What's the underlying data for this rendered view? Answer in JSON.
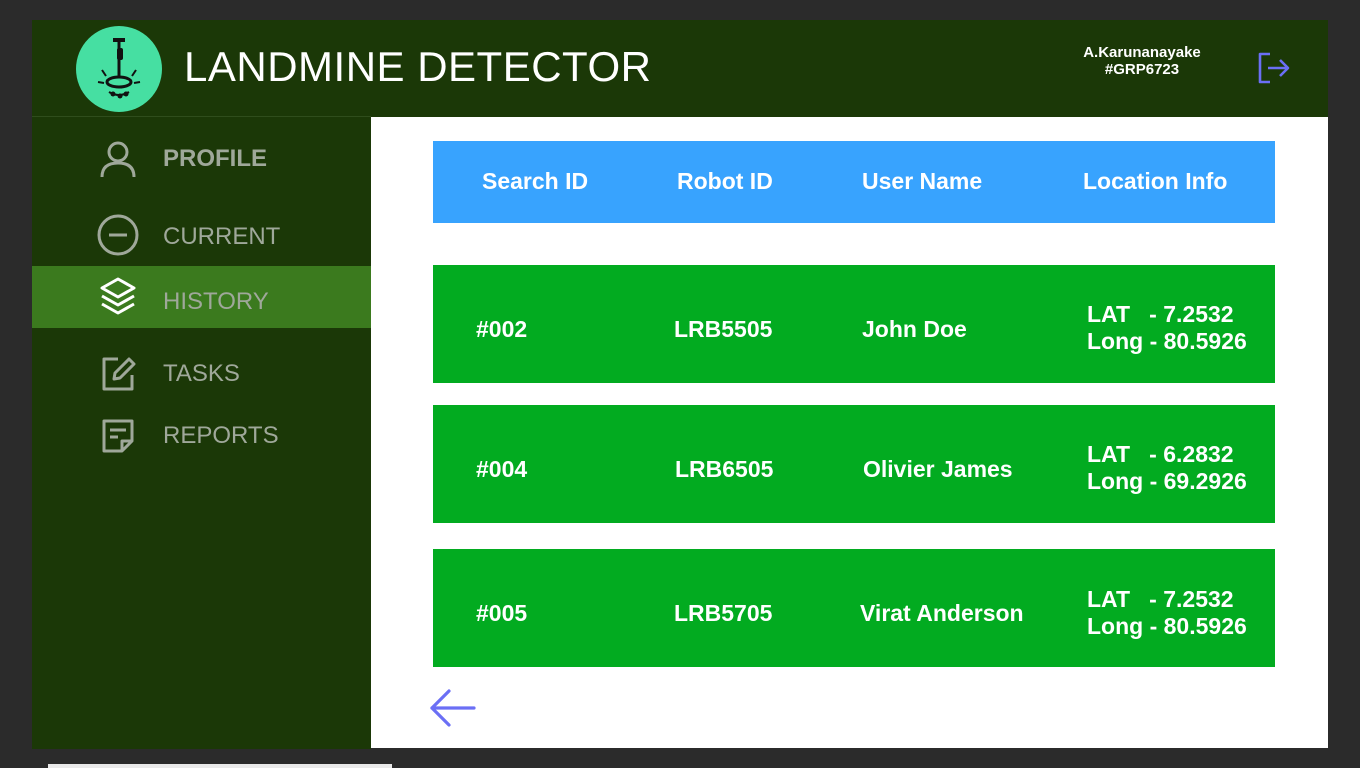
{
  "header": {
    "title": "LANDMINE DETECTOR",
    "user_name": "A.Karunanayake",
    "user_group": "#GRP6723",
    "logout_icon": "logout-icon"
  },
  "sidebar": {
    "items": [
      {
        "label": "PROFILE",
        "icon": "user-icon",
        "active": false
      },
      {
        "label": "CURRENT",
        "icon": "minus-circle-icon",
        "active": false
      },
      {
        "label": "HISTORY",
        "icon": "layers-icon",
        "active": true
      },
      {
        "label": "TASKS",
        "icon": "edit-icon",
        "active": false
      },
      {
        "label": "REPORTS",
        "icon": "report-icon",
        "active": false
      }
    ]
  },
  "table": {
    "headers": [
      "Search ID",
      "Robot ID",
      "User Name",
      "Location Info"
    ],
    "rows": [
      {
        "search_id": "#002",
        "robot_id": "LRB5505",
        "user_name": "John Doe",
        "lat": "LAT   - 7.2532",
        "long": "Long - 80.5926"
      },
      {
        "search_id": "#004",
        "robot_id": "LRB6505",
        "user_name": "Olivier James",
        "lat": "LAT   - 6.2832",
        "long": "Long - 69.2926"
      },
      {
        "search_id": "#005",
        "robot_id": "LRB5705",
        "user_name": "Virat Anderson",
        "lat": "LAT   - 7.2532",
        "long": "Long - 80.5926"
      }
    ]
  },
  "back_icon": "arrow-left-icon",
  "colors": {
    "background": "#1b3807",
    "active_nav": "#3b7a1e",
    "table_header": "#38a3fe",
    "row": "#02ab20",
    "accent": "#6b6ff5",
    "logo": "#46dfa2"
  }
}
